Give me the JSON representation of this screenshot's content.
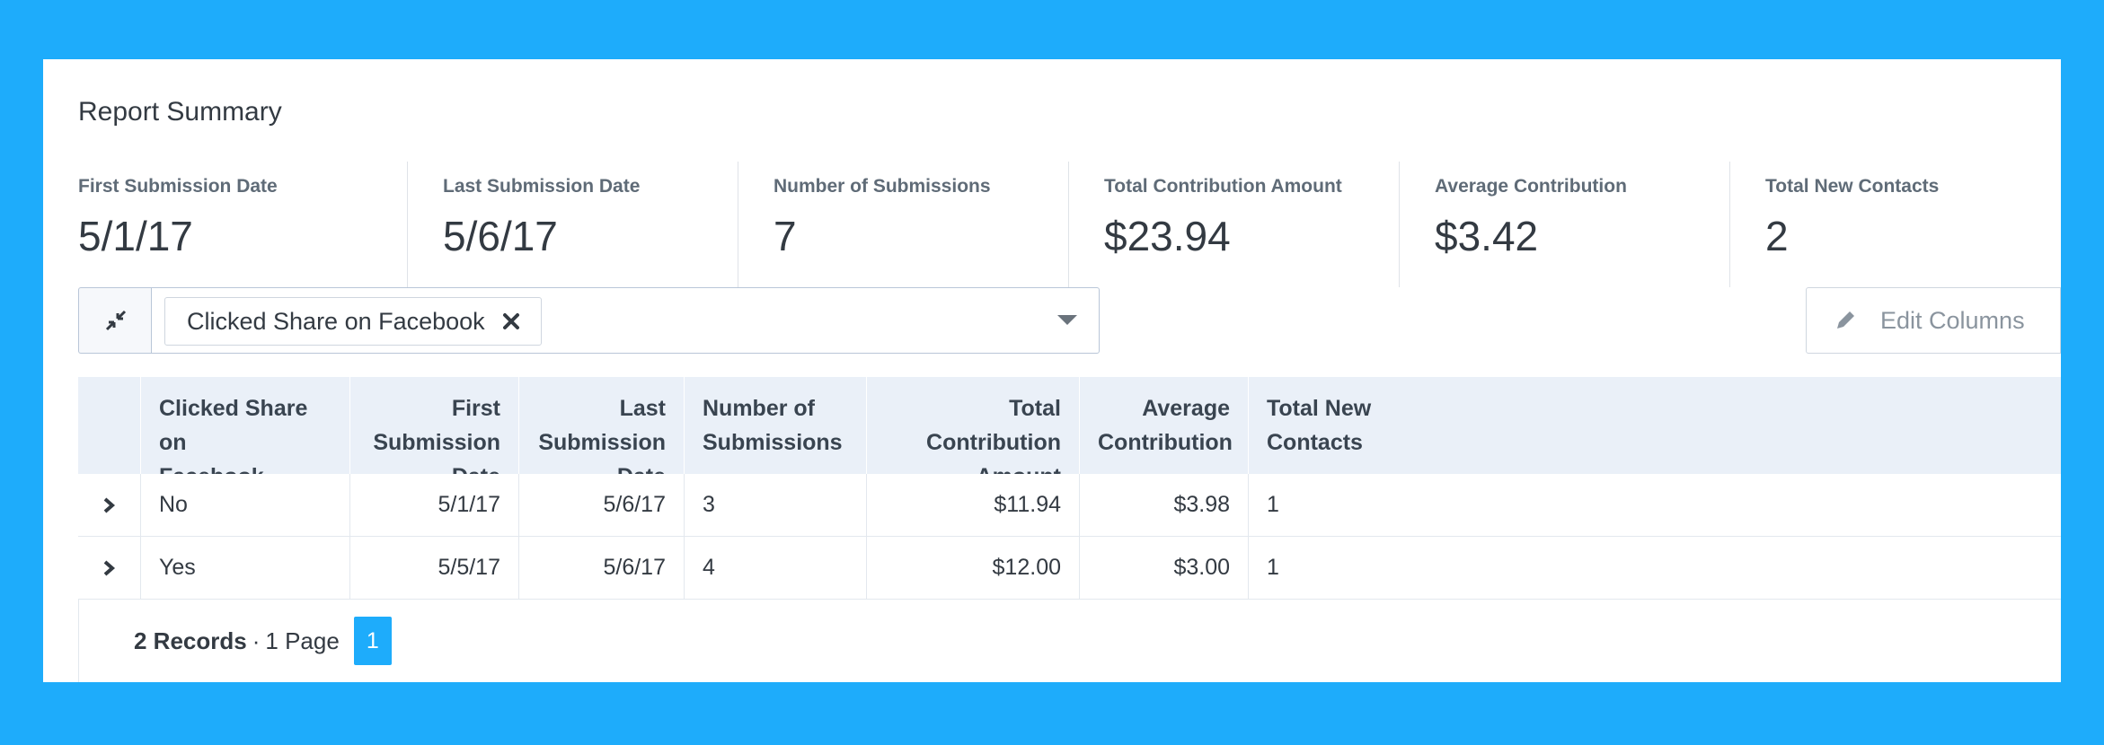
{
  "report": {
    "title": "Report Summary",
    "stats": [
      {
        "label": "First Submission Date",
        "value": "5/1/17"
      },
      {
        "label": "Last Submission Date",
        "value": "5/6/17"
      },
      {
        "label": "Number of Submissions",
        "value": "7"
      },
      {
        "label": "Total Contribution Amount",
        "value": "$23.94"
      },
      {
        "label": "Average Contribution",
        "value": "$3.42"
      },
      {
        "label": "Total New Contacts",
        "value": "2"
      }
    ]
  },
  "filter": {
    "chip_label": "Clicked Share on Facebook",
    "collapse_icon": "collapse-arrows-icon",
    "remove_icon": "close-icon",
    "dropdown_icon": "caret-down-icon"
  },
  "toolbar": {
    "edit_columns_label": "Edit Columns",
    "edit_icon": "pencil-icon"
  },
  "table": {
    "headers": [
      {
        "line1": "Clicked Share on",
        "line2": "Facebook"
      },
      {
        "line1": "First Submission",
        "line2": "Date"
      },
      {
        "line1": "Last Submission",
        "line2": "Date"
      },
      {
        "line1": "Number of",
        "line2": "Submissions"
      },
      {
        "line1": "Total Contribution",
        "line2": "Amount"
      },
      {
        "line1": "Average",
        "line2": "Contribution"
      },
      {
        "line1": "Total New",
        "line2": "Contacts"
      }
    ],
    "rows": [
      {
        "share": "No",
        "first": "5/1/17",
        "last": "5/6/17",
        "count": "3",
        "total": "$11.94",
        "avg": "$3.98",
        "contacts": "1"
      },
      {
        "share": "Yes",
        "first": "5/5/17",
        "last": "5/6/17",
        "count": "4",
        "total": "$12.00",
        "avg": "$3.00",
        "contacts": "1"
      }
    ]
  },
  "pagination": {
    "records": "2 Records",
    "separator": "·",
    "pages": "1 Page",
    "current_page": "1"
  },
  "colors": {
    "background": "#1eacfb",
    "header_bg": "#eaf0f8",
    "accent": "#1eacfb"
  }
}
